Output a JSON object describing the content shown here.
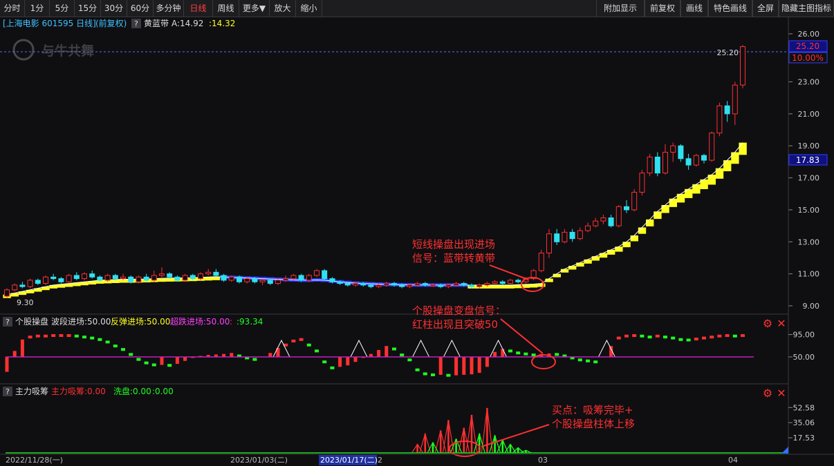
{
  "toolbar": {
    "left": [
      "分时",
      "1分",
      "5分",
      "15分",
      "30分",
      "60分",
      "多分钟",
      "日线",
      "周线",
      "更多▼",
      "放大",
      "缩小"
    ],
    "active": "日线",
    "right": [
      "附加显示",
      "前复权",
      "画线",
      "特色画线",
      "全屏",
      "隐藏主图指标"
    ]
  },
  "main_info": {
    "stock": "[上海电影 601595 日线]",
    "adjust": "(前复权)",
    "q": "?",
    "indicator_name": "黄蓝带",
    "a_label": "A:14.92",
    "b_label": ":14.32"
  },
  "watermark": "与牛共舞",
  "price_axis": {
    "ticks": [
      "26.00",
      "23.00",
      "21.00",
      "19.00",
      "17.00",
      "15.00",
      "13.00",
      "11.00",
      "9.00"
    ],
    "last_price": "25.20",
    "last_pct": "10.00%",
    "band_value": "17.83",
    "high_label": "25.20",
    "low_label": "9.30"
  },
  "sub1": {
    "q": "?",
    "name": "个股操盘",
    "l1": "波段进场:50.00",
    "l2": "反弹进场:50.00",
    "l3": "超跌进场:50.00",
    "l4": ":",
    "l5": ":93.34",
    "ticks": [
      "95.00",
      "50.00"
    ]
  },
  "sub2": {
    "q": "?",
    "name": "主力吸筹",
    "l1": "主力吸筹:0.00",
    "l2": "洗盘:0.00",
    "l3": ":0.00",
    "ticks": [
      "52.58",
      "35.06",
      "17.53"
    ]
  },
  "dates": {
    "d1": "2022/11/28(一)",
    "d2": "2023/01/03(二)",
    "d3": "2023/01/17(二)",
    "d3b": "2",
    "d4": "03",
    "d5": "04"
  },
  "annotations": {
    "a1_line1": "短线操盘出现进场",
    "a1_line2": "信号：蓝带转黄带",
    "a2_line1": "个股操盘变盘信号：",
    "a2_line2": "红柱出现且突破50",
    "a3_line1": "买点：吸筹完毕+",
    "a3_line2": "个股操盘柱体上移"
  },
  "colors": {
    "up": "#ff3030",
    "down": "#30e0f0",
    "band_yellow": "#ffff20",
    "band_blue": "#2a40ff",
    "annotation": "#ff3030",
    "cyan_text": "#40c0ff",
    "magenta": "#c020c0",
    "green": "#20ff20"
  },
  "chart_data": {
    "type": "candlestick",
    "ylim": [
      9.0,
      26.0
    ],
    "candles": [
      [
        9.6,
        10.0,
        9.5,
        10.1
      ],
      [
        10.0,
        10.3,
        9.9,
        10.4
      ],
      [
        10.3,
        10.2,
        10.1,
        10.5
      ],
      [
        10.2,
        10.6,
        10.1,
        10.7
      ],
      [
        10.6,
        10.4,
        10.3,
        10.7
      ],
      [
        10.4,
        10.8,
        10.3,
        10.9
      ],
      [
        10.8,
        10.7,
        10.6,
        11.0
      ],
      [
        10.7,
        10.5,
        10.4,
        10.8
      ],
      [
        10.5,
        10.9,
        10.4,
        11.0
      ],
      [
        10.9,
        10.7,
        10.6,
        11.1
      ],
      [
        10.7,
        11.0,
        10.6,
        11.1
      ],
      [
        11.0,
        10.8,
        10.7,
        11.2
      ],
      [
        10.8,
        10.6,
        10.5,
        10.9
      ],
      [
        10.6,
        10.9,
        10.5,
        11.0
      ],
      [
        10.9,
        10.7,
        10.6,
        11.0
      ],
      [
        10.7,
        10.8,
        10.6,
        11.0
      ],
      [
        10.8,
        10.5,
        10.4,
        10.9
      ],
      [
        10.5,
        10.8,
        10.4,
        10.9
      ],
      [
        10.8,
        10.6,
        10.5,
        11.0
      ],
      [
        10.6,
        10.9,
        10.5,
        11.2
      ],
      [
        10.9,
        11.0,
        10.7,
        11.4
      ],
      [
        11.0,
        10.8,
        10.7,
        11.1
      ],
      [
        10.8,
        10.6,
        10.5,
        10.9
      ],
      [
        10.6,
        10.9,
        10.5,
        11.0
      ],
      [
        10.9,
        10.7,
        10.6,
        11.0
      ],
      [
        10.7,
        11.0,
        10.6,
        11.1
      ],
      [
        11.0,
        11.1,
        10.9,
        11.3
      ],
      [
        11.1,
        10.9,
        10.8,
        11.3
      ],
      [
        10.9,
        10.6,
        10.5,
        11.0
      ],
      [
        10.6,
        10.8,
        10.5,
        10.9
      ],
      [
        10.8,
        10.5,
        10.4,
        10.9
      ],
      [
        10.5,
        10.7,
        10.4,
        10.8
      ],
      [
        10.7,
        10.5,
        10.4,
        10.8
      ],
      [
        10.5,
        10.6,
        10.3,
        10.7
      ],
      [
        10.6,
        10.4,
        10.3,
        10.7
      ],
      [
        10.4,
        10.6,
        10.3,
        10.7
      ],
      [
        10.6,
        10.7,
        10.5,
        10.9
      ],
      [
        10.7,
        10.9,
        10.6,
        11.0
      ],
      [
        10.9,
        10.6,
        10.5,
        11.0
      ],
      [
        10.6,
        10.9,
        10.5,
        11.0
      ],
      [
        10.9,
        11.2,
        10.8,
        11.3
      ],
      [
        11.2,
        10.7,
        10.6,
        11.3
      ],
      [
        10.7,
        10.5,
        10.4,
        10.8
      ],
      [
        10.5,
        10.4,
        10.3,
        10.6
      ],
      [
        10.4,
        10.3,
        10.2,
        10.5
      ],
      [
        10.3,
        10.4,
        10.2,
        10.5
      ],
      [
        10.4,
        10.3,
        10.2,
        10.5
      ],
      [
        10.3,
        10.2,
        10.1,
        10.4
      ],
      [
        10.2,
        10.3,
        10.1,
        10.4
      ],
      [
        10.3,
        10.4,
        10.2,
        10.5
      ],
      [
        10.4,
        10.3,
        10.2,
        10.5
      ],
      [
        10.3,
        10.2,
        10.1,
        10.4
      ],
      [
        10.2,
        10.3,
        10.1,
        10.4
      ],
      [
        10.3,
        10.4,
        10.2,
        10.5
      ],
      [
        10.4,
        10.3,
        10.2,
        10.5
      ],
      [
        10.3,
        10.3,
        10.2,
        10.4
      ],
      [
        10.3,
        10.2,
        10.1,
        10.4
      ],
      [
        10.2,
        10.3,
        10.1,
        10.4
      ],
      [
        10.3,
        10.4,
        10.2,
        10.5
      ],
      [
        10.4,
        10.3,
        10.2,
        10.5
      ],
      [
        10.3,
        10.2,
        10.1,
        10.4
      ],
      [
        10.2,
        10.3,
        10.1,
        10.4
      ],
      [
        10.3,
        10.4,
        10.2,
        10.5
      ],
      [
        10.4,
        10.5,
        10.3,
        10.6
      ],
      [
        10.5,
        10.4,
        10.3,
        10.6
      ],
      [
        10.4,
        10.6,
        10.3,
        10.7
      ],
      [
        10.6,
        10.5,
        10.4,
        10.7
      ],
      [
        10.5,
        10.7,
        10.4,
        10.8
      ],
      [
        10.7,
        11.2,
        10.6,
        11.3
      ],
      [
        11.2,
        12.3,
        11.1,
        12.5
      ],
      [
        12.3,
        13.5,
        12.0,
        13.8
      ],
      [
        13.5,
        13.0,
        12.8,
        13.8
      ],
      [
        13.0,
        13.6,
        12.9,
        13.8
      ],
      [
        13.6,
        13.2,
        13.0,
        13.8
      ],
      [
        13.2,
        13.7,
        13.1,
        13.9
      ],
      [
        13.7,
        14.0,
        13.6,
        14.2
      ],
      [
        14.0,
        14.3,
        13.9,
        14.5
      ],
      [
        14.3,
        14.5,
        14.1,
        14.7
      ],
      [
        14.5,
        14.0,
        13.9,
        14.7
      ],
      [
        14.0,
        15.2,
        13.9,
        15.3
      ],
      [
        15.2,
        15.0,
        14.8,
        15.6
      ],
      [
        15.0,
        16.1,
        14.9,
        16.3
      ],
      [
        16.1,
        17.3,
        15.9,
        17.5
      ],
      [
        17.3,
        18.3,
        17.1,
        18.5
      ],
      [
        18.3,
        17.3,
        17.1,
        18.6
      ],
      [
        17.3,
        18.6,
        17.2,
        19.1
      ],
      [
        18.6,
        19.0,
        18.0,
        19.2
      ],
      [
        19.0,
        18.2,
        18.0,
        19.1
      ],
      [
        18.2,
        17.8,
        17.5,
        18.5
      ],
      [
        17.8,
        18.4,
        17.7,
        18.5
      ],
      [
        18.4,
        18.1,
        17.9,
        18.5
      ],
      [
        18.1,
        19.8,
        18.0,
        19.9
      ],
      [
        19.8,
        21.5,
        19.6,
        21.7
      ],
      [
        21.5,
        21.0,
        20.5,
        21.8
      ],
      [
        21.0,
        22.8,
        20.3,
        23.0
      ],
      [
        22.8,
        25.2,
        22.6,
        25.3
      ]
    ],
    "band": [
      9.7,
      9.8,
      9.9,
      10.0,
      10.1,
      10.2,
      10.3,
      10.35,
      10.4,
      10.45,
      10.5,
      10.55,
      10.6,
      10.62,
      10.64,
      10.66,
      10.66,
      10.67,
      10.68,
      10.7,
      10.72,
      10.73,
      10.74,
      10.75,
      10.76,
      10.78,
      10.8,
      10.82,
      10.8,
      10.78,
      10.76,
      10.74,
      10.72,
      10.7,
      10.68,
      10.66,
      10.64,
      10.62,
      10.6,
      10.6,
      10.62,
      10.6,
      10.55,
      10.5,
      10.46,
      10.42,
      10.4,
      10.38,
      10.36,
      10.34,
      10.33,
      10.32,
      10.31,
      10.3,
      10.3,
      10.3,
      10.3,
      10.3,
      10.3,
      10.3,
      10.3,
      10.3,
      10.3,
      10.3,
      10.3,
      10.3,
      10.32,
      10.34,
      10.36,
      10.4,
      10.7,
      11.0,
      11.3,
      11.5,
      11.7,
      11.9,
      12.1,
      12.3,
      12.5,
      12.7,
      13.0,
      13.4,
      13.9,
      14.4,
      14.9,
      15.3,
      15.7,
      16.0,
      16.3,
      16.6,
      16.9,
      17.2,
      17.6,
      18.1,
      18.6,
      19.2
    ],
    "band_yellow": [
      true,
      true,
      true,
      true,
      true,
      true,
      true,
      true,
      true,
      true,
      true,
      true,
      true,
      true,
      true,
      true,
      true,
      true,
      true,
      true,
      true,
      true,
      true,
      true,
      true,
      true,
      true,
      true,
      false,
      false,
      false,
      false,
      false,
      false,
      false,
      false,
      false,
      false,
      false,
      false,
      false,
      false,
      false,
      false,
      false,
      false,
      false,
      false,
      false,
      false,
      false,
      false,
      false,
      false,
      false,
      false,
      false,
      false,
      false,
      false,
      true,
      true,
      true,
      true,
      true,
      true,
      true,
      true,
      true,
      true,
      true,
      true,
      true,
      true,
      true,
      true,
      true,
      true,
      true,
      true,
      true,
      true,
      true,
      true,
      true,
      true,
      true,
      true,
      true,
      true,
      true,
      true,
      true,
      true,
      true,
      true
    ],
    "sub1": {
      "ylim": [
        0,
        100
      ],
      "level": 50,
      "values": [
        20,
        62,
        85,
        90,
        92,
        92,
        93,
        93,
        93,
        92,
        90,
        88,
        85,
        80,
        72,
        65,
        55,
        45,
        38,
        34,
        34,
        33,
        36,
        42,
        48,
        52,
        54,
        55,
        56,
        58,
        52,
        48,
        45,
        50,
        58,
        68,
        74,
        82,
        85,
        74,
        62,
        40,
        28,
        30,
        33,
        40,
        48,
        56,
        64,
        72,
        66,
        54,
        44,
        24,
        16,
        14,
        14,
        13,
        13,
        14,
        15,
        18,
        30,
        60,
        66,
        62,
        58,
        56,
        54,
        56,
        57,
        55,
        52,
        48,
        44,
        42,
        40,
        50,
        72,
        88,
        92,
        93,
        92,
        90,
        92,
        90,
        88,
        85,
        84,
        86,
        88,
        90,
        92,
        93,
        92,
        93
      ],
      "triangles": [
        35,
        45,
        53,
        57,
        63,
        77
      ]
    },
    "sub2": {
      "ylim": [
        0,
        60
      ],
      "red_spikes": [
        [
          53,
          10
        ],
        [
          54,
          22
        ],
        [
          56,
          26
        ],
        [
          57,
          38
        ],
        [
          59,
          29
        ],
        [
          60,
          44
        ],
        [
          62,
          52
        ]
      ],
      "green_spikes": [
        [
          55,
          12
        ],
        [
          58,
          16
        ],
        [
          61,
          22
        ],
        [
          63,
          20
        ],
        [
          64,
          15
        ],
        [
          65,
          10
        ],
        [
          66,
          6
        ],
        [
          67,
          3
        ]
      ]
    }
  }
}
